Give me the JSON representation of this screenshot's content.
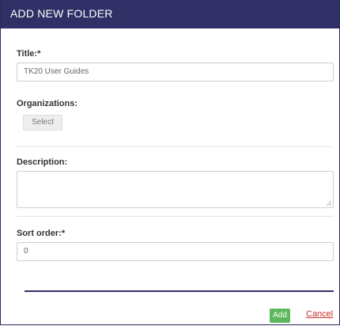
{
  "dialog": {
    "title": "ADD NEW FOLDER"
  },
  "form": {
    "title_label": "Title:*",
    "title_value": "TK20 User Guides",
    "organizations_label": "Organizations:",
    "select_label": "Select",
    "description_label": "Description:",
    "description_value": "",
    "sort_order_label": "Sort order:*",
    "sort_order_value": "0"
  },
  "actions": {
    "add_label": "Add",
    "cancel_label": "Cancel"
  },
  "colors": {
    "header_bg": "#303066",
    "add_button": "#5cb85c",
    "cancel_link": "#c9302c"
  }
}
